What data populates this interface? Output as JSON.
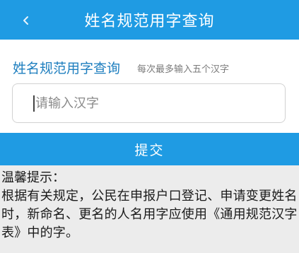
{
  "header": {
    "title": "姓名规范用字查询"
  },
  "form": {
    "heading": "姓名规范用字查询",
    "hint": "每次最多输入五个汉字",
    "input_placeholder": "请输入汉字",
    "input_value": ""
  },
  "submit": {
    "label": "提交"
  },
  "tips": {
    "title": "温馨提示：",
    "body": "根据有关规定，公民在申报户口登记、申请变更姓名时，新命名、更名的人名用字应使用《通用规范汉字表》中的字。"
  },
  "colors": {
    "primary": "#1f9be3",
    "heading_text": "#1f7fbf",
    "background": "#ececec"
  },
  "icons": {
    "back": "back-arrow-icon"
  }
}
